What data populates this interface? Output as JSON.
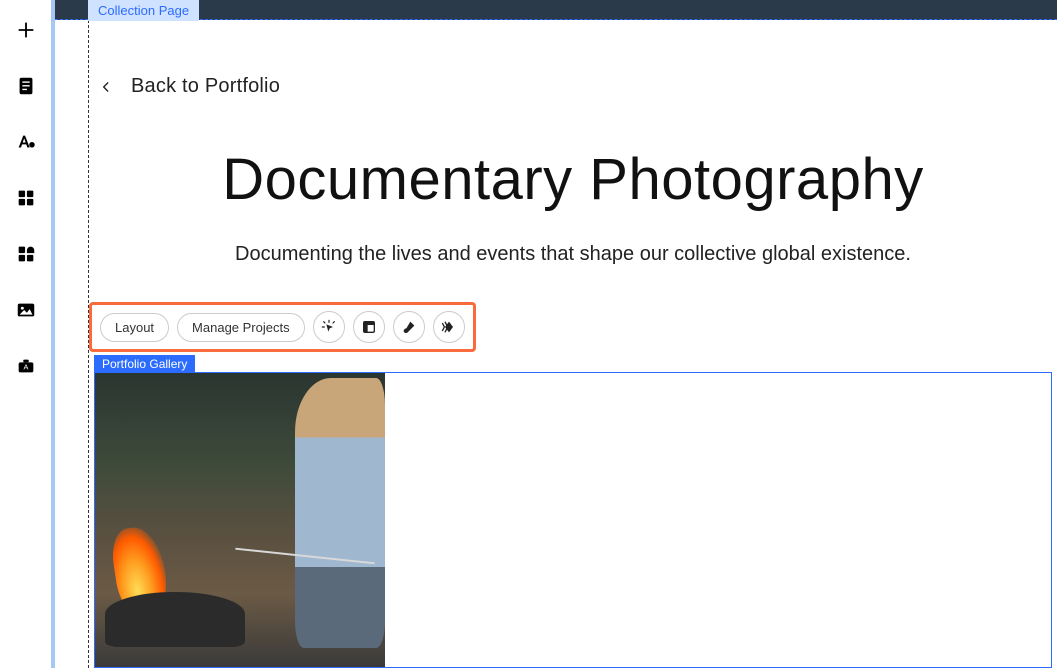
{
  "labels": {
    "collection_page": "Collection Page",
    "portfolio_gallery": "Portfolio Gallery"
  },
  "nav": {
    "back_text": "Back to Portfolio"
  },
  "page": {
    "title": "Documentary Photography",
    "subtitle": "Documenting the lives and events that shape our collective global existence."
  },
  "toolbar": {
    "layout": "Layout",
    "manage_projects": "Manage Projects"
  },
  "sidebar_icons": [
    "plus",
    "page",
    "text-style",
    "grid",
    "apps",
    "image",
    "briefcase-a"
  ],
  "toolbar_icons": [
    "cursor-click",
    "layout-preset",
    "brush",
    "animation"
  ]
}
